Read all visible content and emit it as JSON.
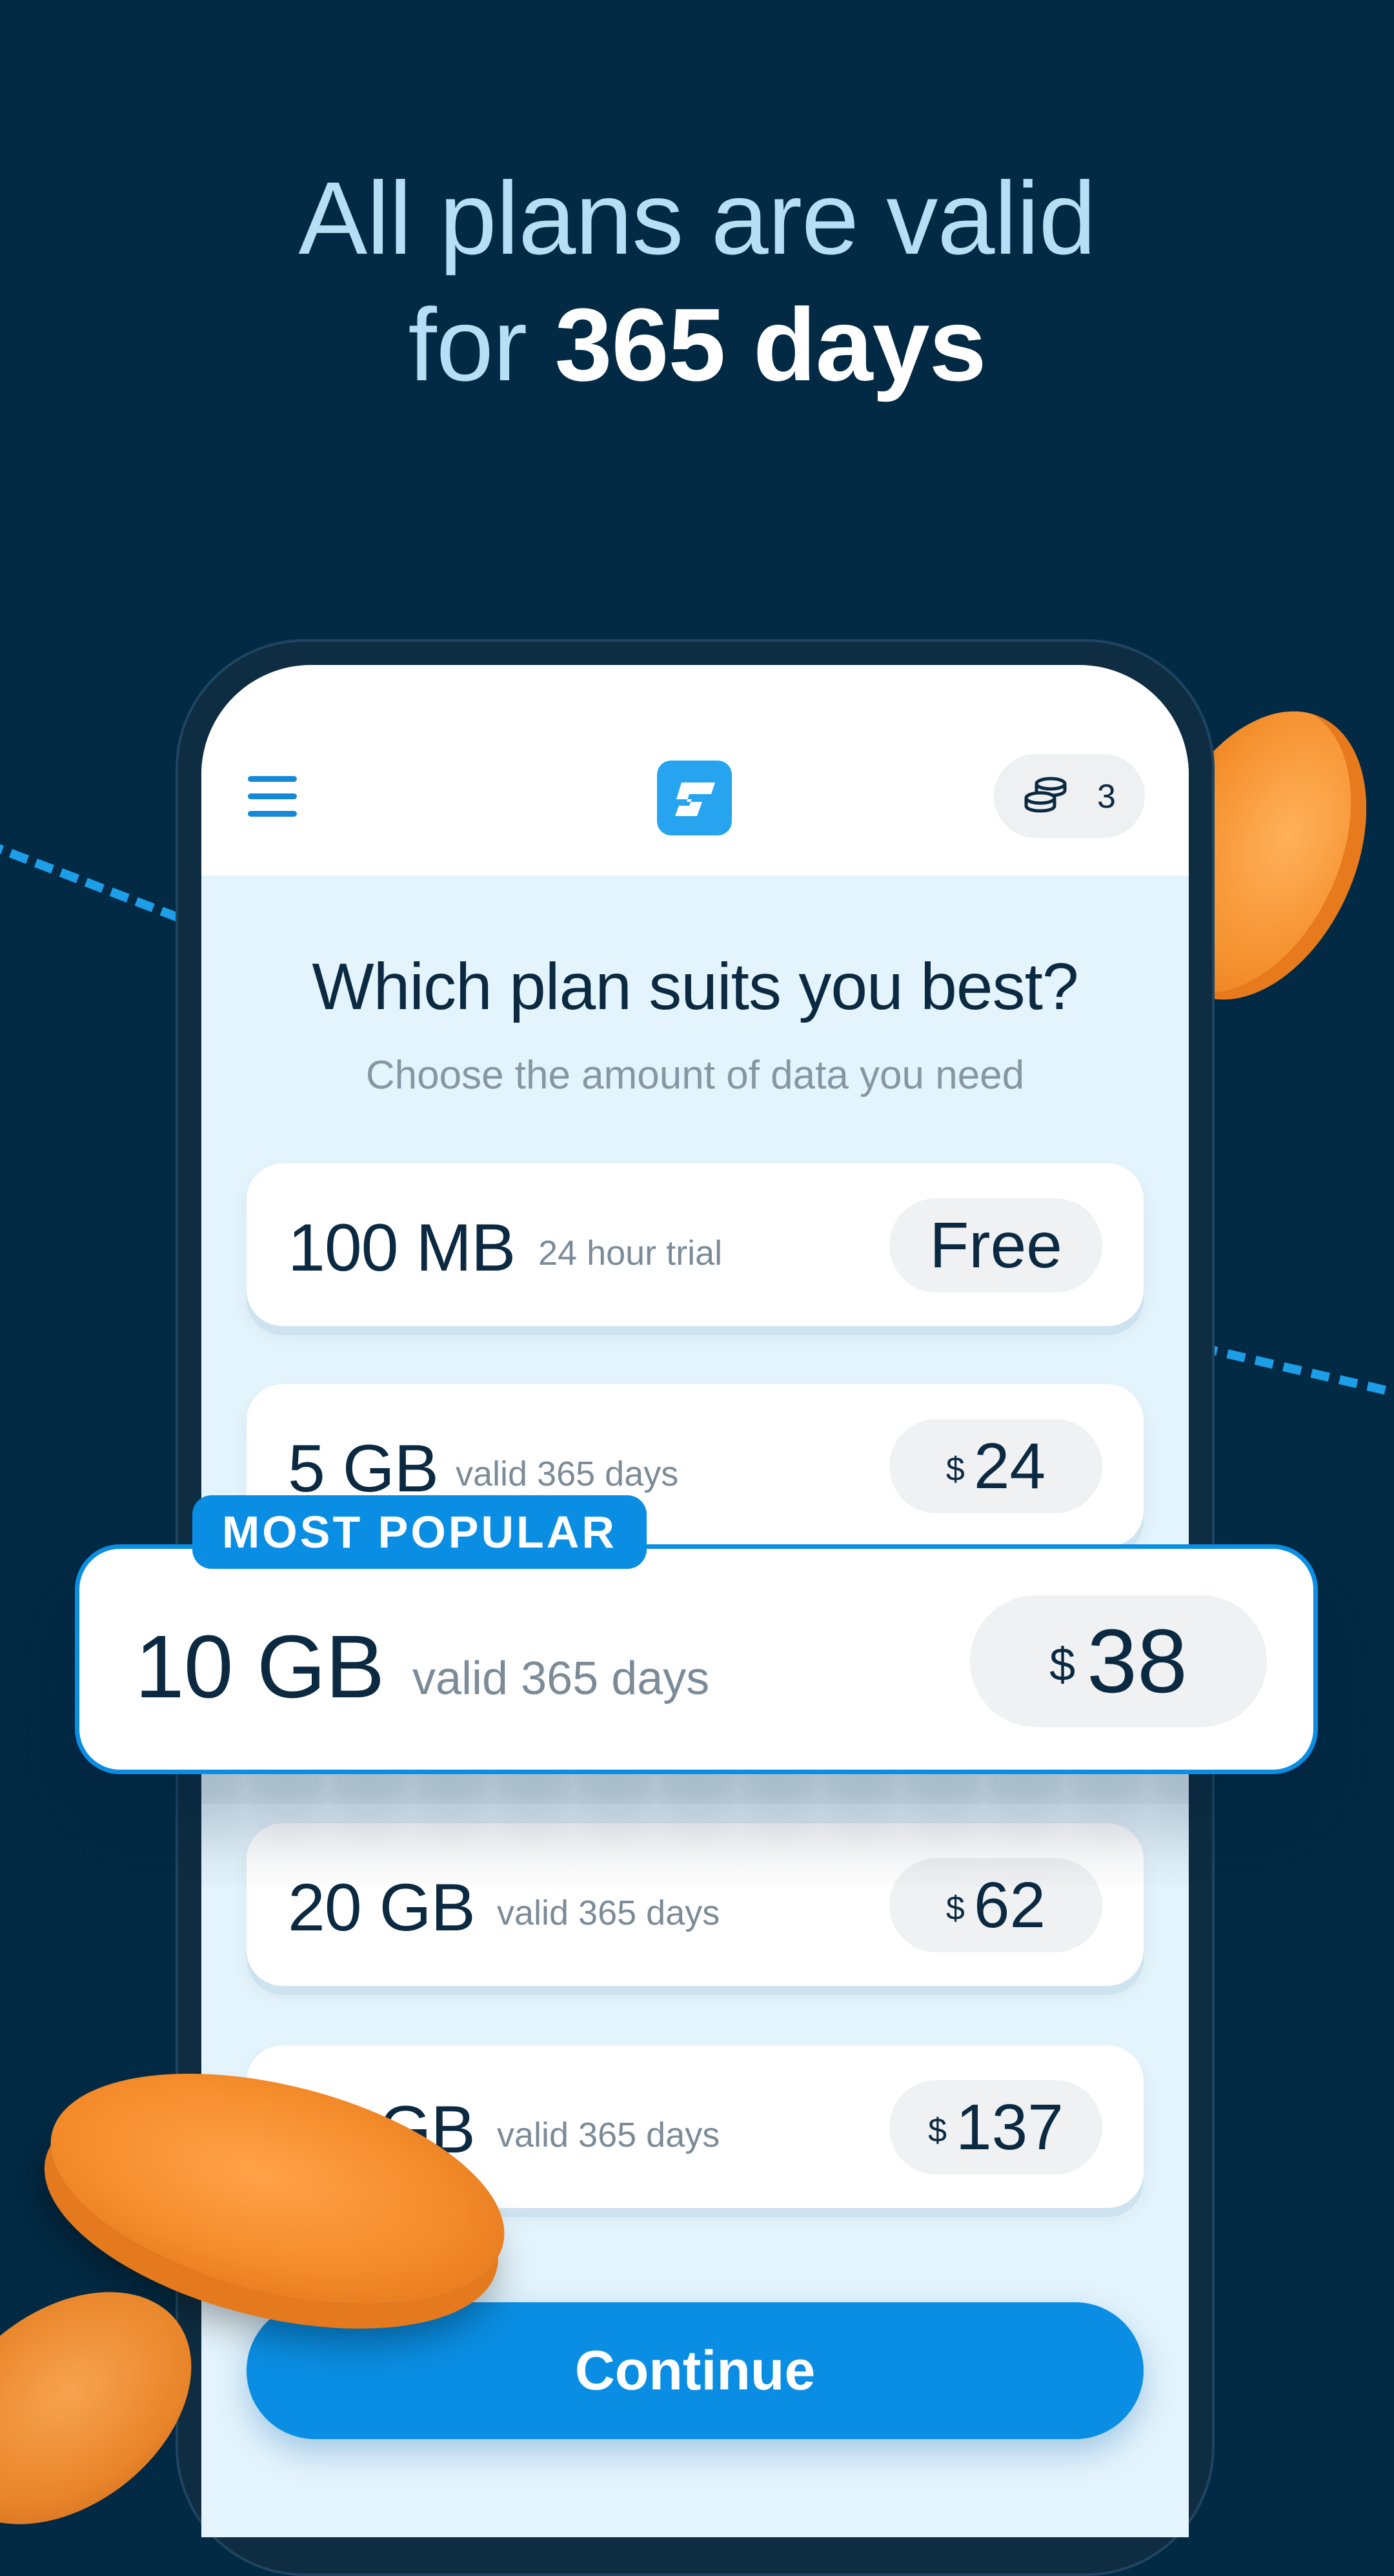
{
  "headline": {
    "line1": "All plans are valid",
    "line2_prefix": "for ",
    "line2_bold": "365 days"
  },
  "app": {
    "coins_count": "3"
  },
  "screen": {
    "title": "Which plan suits you best?",
    "subtitle": "Choose the amount of data you need"
  },
  "plans": [
    {
      "size": "100 MB",
      "note": "24 hour trial",
      "price_label": "Free"
    },
    {
      "size": "5 GB",
      "note": "valid 365 days",
      "currency": "$",
      "price": "24"
    },
    {
      "size": "10 GB",
      "note": "valid 365 days",
      "currency": "$",
      "price": "38",
      "badge": "MOST POPULAR"
    },
    {
      "size": "20 GB",
      "note": "valid 365 days",
      "currency": "$",
      "price": "62"
    },
    {
      "size": "50 GB",
      "note": "valid 365 days",
      "currency": "$",
      "price": "137"
    }
  ],
  "continue_label": "Continue",
  "colors": {
    "background": "#022a44",
    "accent": "#0a8ee3",
    "headline": "#b6def5",
    "coin": "#f5902e"
  }
}
